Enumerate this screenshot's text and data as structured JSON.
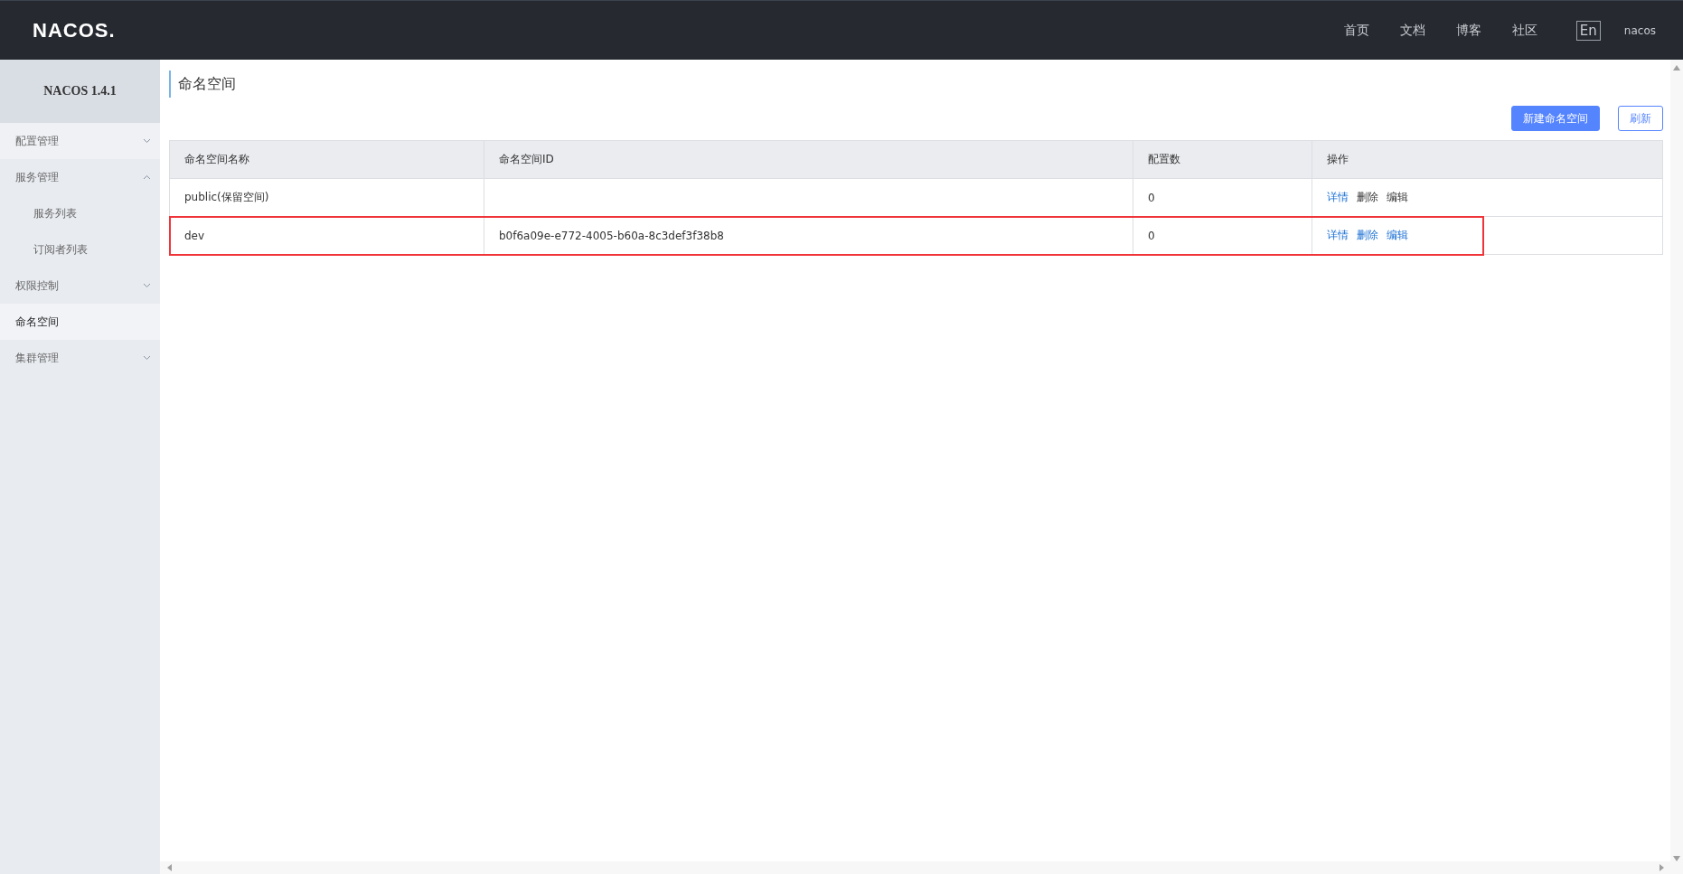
{
  "header": {
    "logo": "NACOS.",
    "nav": [
      {
        "label": "首页"
      },
      {
        "label": "文档"
      },
      {
        "label": "博客"
      },
      {
        "label": "社区"
      }
    ],
    "language": "En",
    "user": "nacos"
  },
  "sidebar": {
    "title": "NACOS 1.4.1",
    "items": [
      {
        "kind": "group",
        "label": "配置管理",
        "expanded": false,
        "selected": false
      },
      {
        "kind": "group",
        "label": "服务管理",
        "expanded": true,
        "selected": false,
        "children": [
          {
            "label": "服务列表",
            "selected": false
          },
          {
            "label": "订阅者列表",
            "selected": false
          }
        ]
      },
      {
        "kind": "group",
        "label": "权限控制",
        "expanded": false,
        "selected": false
      },
      {
        "kind": "link",
        "label": "命名空间",
        "selected": true
      },
      {
        "kind": "group",
        "label": "集群管理",
        "expanded": false,
        "selected": false
      }
    ]
  },
  "page": {
    "title": "命名空间",
    "buttons": [
      {
        "kind": "primary",
        "label": "新建命名空间"
      },
      {
        "kind": "outline",
        "label": "刷新"
      }
    ]
  },
  "table": {
    "columns": [
      "命名空间名称",
      "命名空间ID",
      "配置数",
      "操作"
    ],
    "rows": [
      {
        "name": "public(保留空间)",
        "id": "",
        "count": "0",
        "highlighted": false,
        "actions": [
          {
            "label": "详情",
            "disabled": false
          },
          {
            "label": "删除",
            "disabled": true
          },
          {
            "label": "编辑",
            "disabled": true
          }
        ]
      },
      {
        "name": "dev",
        "id": "b0f6a09e-e772-4005-b60a-8c3def3f38b8",
        "count": "0",
        "highlighted": true,
        "actions": [
          {
            "label": "详情",
            "disabled": false
          },
          {
            "label": "删除",
            "disabled": false
          },
          {
            "label": "编辑",
            "disabled": false
          }
        ]
      }
    ]
  }
}
